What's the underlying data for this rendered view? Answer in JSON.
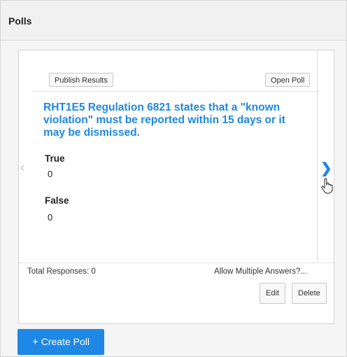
{
  "panel": {
    "title": "Polls"
  },
  "poll": {
    "publish_label": "Publish Results",
    "open_label": "Open Poll",
    "question": "RHT1E5 Regulation 6821 states that a \"known violation\" must be reported within 15 days or it may be dismissed.",
    "options": [
      {
        "label": "True",
        "count": "0"
      },
      {
        "label": "False",
        "count": "0"
      }
    ],
    "prev_icon": "chevron-left-icon",
    "next_icon": "chevron-right-icon"
  },
  "footer": {
    "total_responses": "Total Responses: 0",
    "allow_multiple": "Allow Multiple Answers?",
    "edit_label": "Edit",
    "delete_label": "Delete"
  },
  "create_button": {
    "label": "Create Poll",
    "icon": "plus-icon"
  },
  "colors": {
    "accent": "#1e88e5",
    "panel_bg": "#f5f5f5"
  }
}
